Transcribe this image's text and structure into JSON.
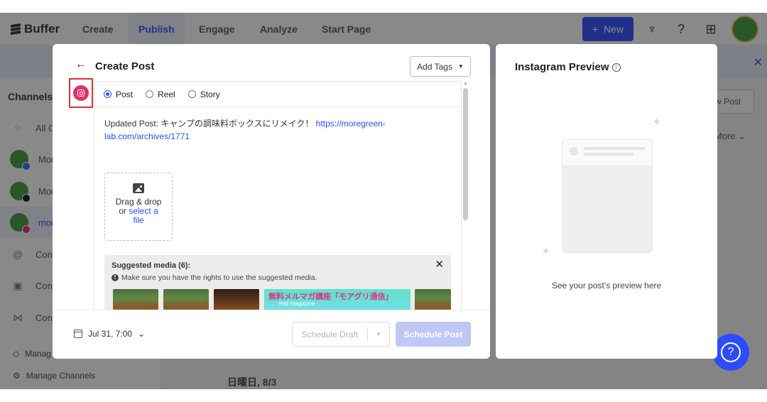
{
  "app": {
    "logo": "Buffer",
    "nav_tabs": [
      "Create",
      "Publish",
      "Engage",
      "Analyze",
      "Start Page"
    ],
    "new_button": "New",
    "sidebar": {
      "title": "Channels",
      "items": [
        "All C",
        "More",
        "More",
        "more",
        "Conn",
        "Conn",
        "Conn"
      ],
      "manage_tags": "Manag",
      "manage_channels": "Manage Channels"
    },
    "date_label": "日曜日, 8/3",
    "right_button": "w Post",
    "right_more": "More"
  },
  "composer": {
    "title": "Create Post",
    "add_tags": "Add Tags",
    "channel_icon": "instagram-icon",
    "post_types": [
      "Post",
      "Reel",
      "Story"
    ],
    "selected_type": "Post",
    "text_prefix": "Updated Post: キャンプの調味料ボックスにリメイク！ ",
    "link_line1": "https://moregreen-",
    "link_line2": "lab.com/archives/1771",
    "dropzone": {
      "line1": "Drag & drop",
      "or": "or ",
      "link": "select a",
      "line3": "file"
    },
    "suggested": {
      "title": "Suggested media (6):",
      "note": "Make sure you have the rights to use the suggested media.",
      "banner_text": "無料メルマガ講座「モアグリ通信」",
      "banner_sub": "mail magazine"
    },
    "footer": {
      "date": "Jul 31, 7:00",
      "schedule_draft": "Schedule Draft",
      "schedule_post": "Schedule Post"
    }
  },
  "preview": {
    "title": "Instagram Preview",
    "caption": "See your post's preview here"
  },
  "colors": {
    "accent": "#2c4bff",
    "instagram": "#e1306c",
    "highlight": "#e03131"
  }
}
